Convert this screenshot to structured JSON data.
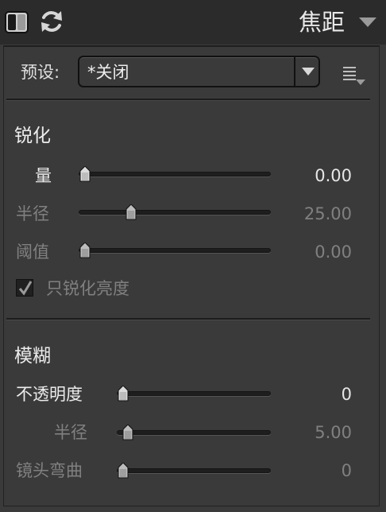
{
  "header": {
    "title": "焦距",
    "icons": [
      "compare-view-icon",
      "reset-icon",
      "collapse-triangle-icon"
    ]
  },
  "preset": {
    "label": "预设:",
    "value": "*关闭"
  },
  "sharpen": {
    "title": "锐化",
    "sliders": [
      {
        "label": "量",
        "value": "0.00",
        "level": 0.0,
        "enabled": true
      },
      {
        "label": "半径",
        "value": "25.00",
        "level": 0.25,
        "enabled": false
      },
      {
        "label": "阈值",
        "value": "0.00",
        "level": 0.0,
        "enabled": false
      }
    ],
    "checkbox": {
      "label": "只锐化亮度",
      "checked": true
    }
  },
  "blur": {
    "title": "模糊",
    "sliders": [
      {
        "label": "不透明度",
        "value": "0",
        "level": 0.0,
        "enabled": true
      },
      {
        "label": "半径",
        "value": "5.00",
        "level": 0.03,
        "enabled": false
      },
      {
        "label": "镜头弯曲",
        "value": "0",
        "level": 0.0,
        "enabled": false
      }
    ]
  },
  "colors": {
    "background": "#3a3a3a",
    "header": "#2b2b2b",
    "text_enabled": "#ececec",
    "text_disabled": "#808080"
  }
}
